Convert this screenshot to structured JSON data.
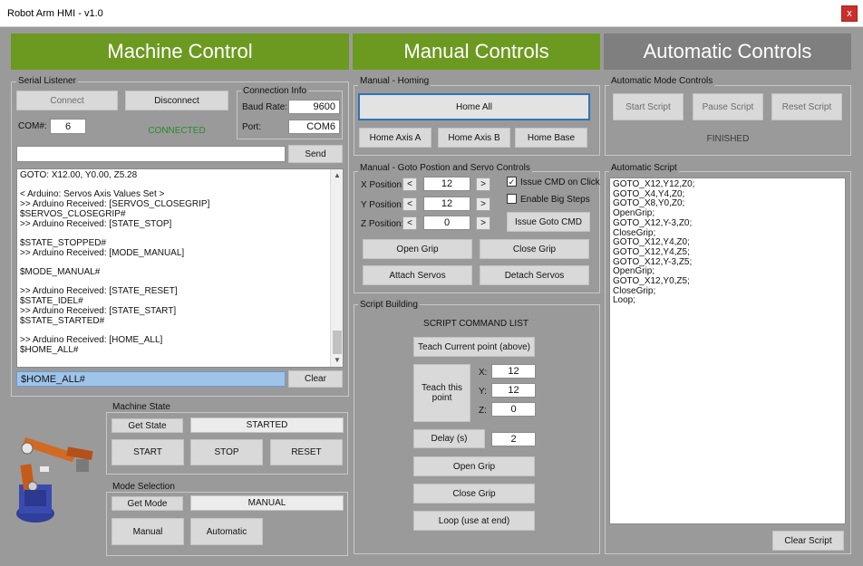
{
  "window": {
    "title": "Robot Arm HMI - v1.0",
    "close_label": "x"
  },
  "headers": {
    "machine": "Machine Control",
    "manual": "Manual Controls",
    "automatic": "Automatic Controls"
  },
  "serial": {
    "group_title": "Serial Listener",
    "connect": "Connect",
    "disconnect": "Disconnect",
    "com_label": "COM#:",
    "com_value": "6",
    "status": "CONNECTED",
    "conn_info_title": "Connection Info",
    "baud_label": "Baud Rate:",
    "baud_value": "9600",
    "port_label": "Port:",
    "port_value": "COM6",
    "send_input": "",
    "send": "Send",
    "log": "GOTO: X12.00, Y0.00, Z5.28\n\n< Arduino: Servos Axis Values Set >\n>> Arduino Received: [SERVOS_CLOSEGRIP]\n$SERVOS_CLOSEGRIP#\n>> Arduino Received: [STATE_STOP]\n\n$STATE_STOPPED#\n>> Arduino Received: [MODE_MANUAL]\n\n$MODE_MANUAL#\n\n>> Arduino Received: [STATE_RESET]\n$STATE_IDEL#\n>> Arduino Received: [STATE_START]\n$STATE_STARTED#\n\n>> Arduino Received: [HOME_ALL]\n$HOME_ALL#",
    "last_line": "$HOME_ALL#",
    "clear": "Clear"
  },
  "machine_state": {
    "title": "Machine State",
    "get_state": "Get State",
    "state": "STARTED",
    "start": "START",
    "stop": "STOP",
    "reset": "RESET"
  },
  "mode": {
    "title": "Mode Selection",
    "get_mode": "Get Mode",
    "mode": "MANUAL",
    "manual": "Manual",
    "automatic": "Automatic"
  },
  "homing": {
    "title": "Manual - Homing",
    "home_all": "Home All",
    "axis_a": "Home Axis A",
    "axis_b": "Home Axis B",
    "base": "Home Base"
  },
  "goto": {
    "title": "Manual - Goto Postion and Servo Controls",
    "x_label": "X Position:",
    "x_value": "12",
    "y_label": "Y Position:",
    "y_value": "12",
    "z_label": "Z Position:",
    "z_value": "0",
    "dec": "<",
    "inc": ">",
    "issue_on_click": "Issue CMD on Click",
    "issue_on_click_checked": true,
    "big_steps": "Enable Big Steps",
    "big_steps_checked": false,
    "issue_goto": "Issue Goto CMD",
    "open_grip": "Open Grip",
    "close_grip": "Close Grip",
    "attach": "Attach Servos",
    "detach": "Detach Servos"
  },
  "script_building": {
    "title": "Script Building",
    "list_title": "SCRIPT COMMAND LIST",
    "teach_current": "Teach Current point (above)",
    "teach_point": "Teach this point",
    "x_label": "X:",
    "x_value": "12",
    "y_label": "Y:",
    "y_value": "12",
    "z_label": "Z:",
    "z_value": "0",
    "delay": "Delay (s)",
    "delay_value": "2",
    "open_grip": "Open Grip",
    "close_grip": "Close Grip",
    "loop": "Loop (use at end)"
  },
  "auto": {
    "title": "Automatic Mode Controls",
    "start": "Start Script",
    "pause": "Pause Script",
    "reset": "Reset Script",
    "status": "FINISHED",
    "script_title": "Automatic Script",
    "script": "GOTO_X12,Y12,Z0;\nGOTO_X4,Y4,Z0;\nGOTO_X8,Y0,Z0;\nOpenGrip;\nGOTO_X12,Y-3,Z0;\nCloseGrip;\nGOTO_X12,Y4,Z0;\nGOTO_X12,Y4,Z5;\nGOTO_X12,Y-3,Z5;\nOpenGrip;\nGOTO_X12,Y0,Z5;\nCloseGrip;\nLoop;",
    "clear": "Clear Script"
  },
  "colors": {
    "accent_green": "#6c9a20",
    "header_grey": "#7f7f7f",
    "status_green": "#2a8a2a",
    "selection_blue": "#9fc4ea"
  },
  "icons": {
    "robot": "robot-arm-illustration"
  }
}
